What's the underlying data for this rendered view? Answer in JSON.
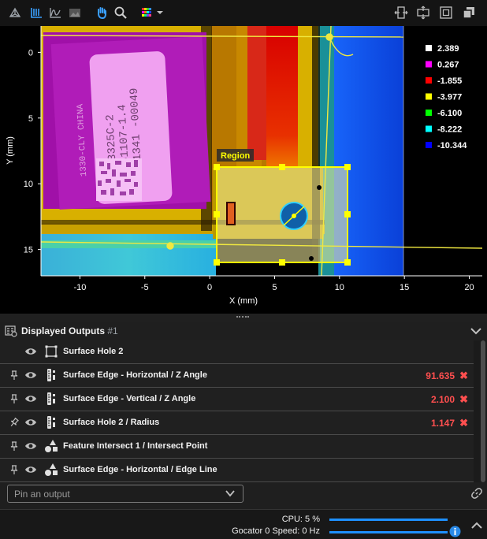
{
  "toolbar": {
    "left_icons": [
      "3d-view-icon",
      "profile-view-icon",
      "section-view-icon",
      "image-view-icon",
      "pan-hand-icon",
      "zoom-icon",
      "color-palette-icon"
    ],
    "right_icons": [
      "fit-width-icon",
      "fit-height-icon",
      "fit-all-icon",
      "popout-window-icon"
    ]
  },
  "chart_data": {
    "type": "heatmap",
    "xlabel": "X (mm)",
    "ylabel": "Y (mm)",
    "xlim": [
      -13,
      21
    ],
    "ylim": [
      17,
      -2
    ],
    "x_ticks": [
      "-10",
      "-5",
      "0",
      "5",
      "10",
      "15",
      "20"
    ],
    "y_ticks": [
      "0",
      "5",
      "10",
      "15"
    ],
    "region_label": "Region",
    "legend": [
      {
        "value": "2.389",
        "color": "#ffffff"
      },
      {
        "value": "0.267",
        "color": "#ff00ff"
      },
      {
        "value": "-1.855",
        "color": "#ff0000"
      },
      {
        "value": "-3.977",
        "color": "#ffff00"
      },
      {
        "value": "-6.100",
        "color": "#00ff00"
      },
      {
        "value": "-8.222",
        "color": "#00ffff"
      },
      {
        "value": "-10.344",
        "color": "#0000ff"
      }
    ],
    "label_text": [
      "03325C-2",
      "281107-1.4",
      "DS1341 -00049",
      "1330-CLY CHINA"
    ]
  },
  "outputs_panel": {
    "title": "Displayed Outputs",
    "count": "#1",
    "rows": [
      {
        "label": "Surface Hole 2",
        "value": "",
        "pinned": "none",
        "type_icon": "region-box-icon"
      },
      {
        "label": "Surface Edge - Horizontal / Z Angle",
        "value": "91.635",
        "pinned": "pin",
        "type_icon": "measurement-ruler-icon"
      },
      {
        "label": "Surface Edge - Vertical / Z Angle",
        "value": "2.100",
        "pinned": "pin",
        "type_icon": "measurement-ruler-icon"
      },
      {
        "label": "Surface Hole 2 / Radius",
        "value": "1.147",
        "pinned": "pin-tilted",
        "type_icon": "measurement-ruler-icon"
      },
      {
        "label": "Feature Intersect 1 / Intersect Point",
        "value": "",
        "pinned": "pin",
        "type_icon": "shapes-icon"
      },
      {
        "label": "Surface Edge - Horizontal / Edge Line",
        "value": "",
        "pinned": "pin",
        "type_icon": "shapes-icon"
      }
    ],
    "pin_placeholder": "Pin an output"
  },
  "status": {
    "cpu_label": "CPU: 5 %",
    "cpu_percent": 5,
    "speed_label": "Gocator 0 Speed: 0 Hz",
    "speed_value": 0
  }
}
